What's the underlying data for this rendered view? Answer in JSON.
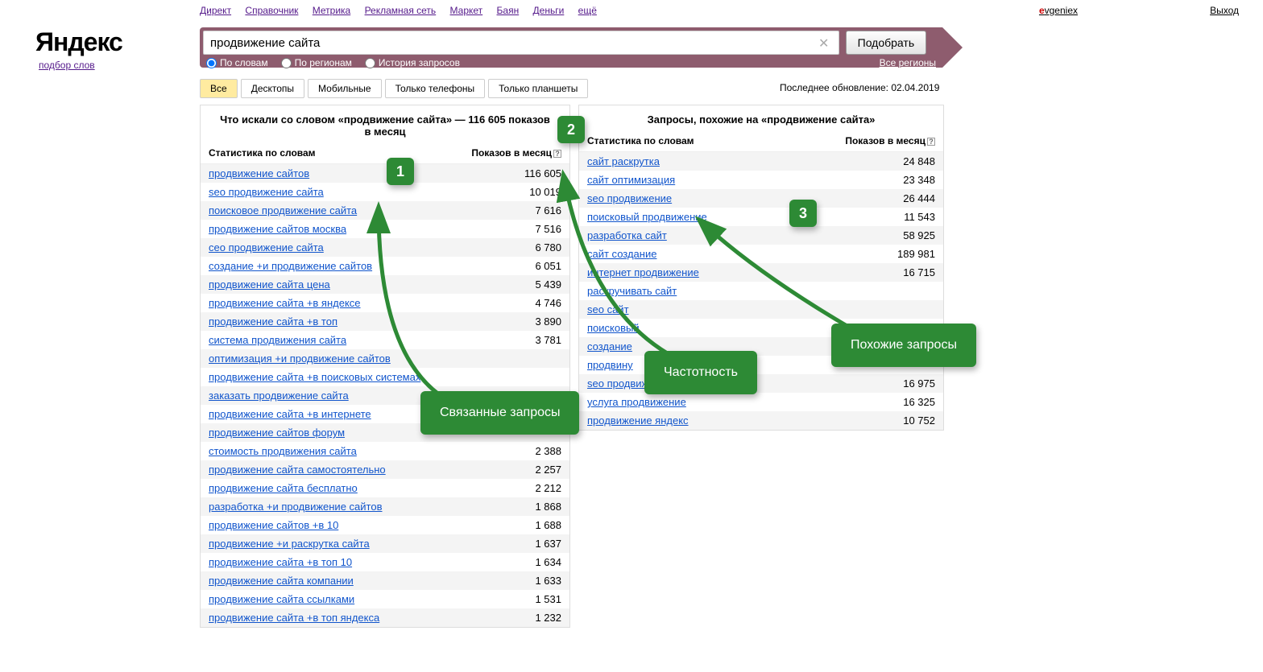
{
  "nav": {
    "links": [
      "Директ",
      "Справочник",
      "Метрика",
      "Рекламная сеть",
      "Маркет",
      "Баян",
      "Деньги",
      "ещё"
    ],
    "user": "vgeniex",
    "logout": "Выход"
  },
  "logo": {
    "brand": "Яндекс",
    "sub": "подбор слов"
  },
  "search": {
    "value": "продвижение сайта",
    "button": "Подобрать",
    "radio_words": "По словам",
    "radio_regions": "По регионам",
    "radio_history": "История запросов",
    "all_regions": "Все регионы"
  },
  "device_tabs": [
    "Все",
    "Десктопы",
    "Мобильные",
    "Только телефоны",
    "Только планшеты"
  ],
  "last_update": "Последнее обновление: 02.04.2019",
  "left_panel": {
    "title": "Что искали со словом «продвижение сайта» — 116 605 показов в месяц",
    "col1": "Статистика по словам",
    "col2": "Показов в месяц",
    "rows": [
      {
        "q": "продвижение сайтов",
        "n": "116 605"
      },
      {
        "q": "seo продвижение сайта",
        "n": "10 019"
      },
      {
        "q": "поисковое продвижение сайта",
        "n": "7 616"
      },
      {
        "q": "продвижение сайтов москва",
        "n": "7 516"
      },
      {
        "q": "сео продвижение сайта",
        "n": "6 780"
      },
      {
        "q": "создание +и продвижение сайтов",
        "n": "6 051"
      },
      {
        "q": "продвижение сайта цена",
        "n": "5 439"
      },
      {
        "q": "продвижение сайта +в яндексе",
        "n": "4 746"
      },
      {
        "q": "продвижение сайта +в топ",
        "n": "3 890"
      },
      {
        "q": "система продвижения сайта",
        "n": "3 781"
      },
      {
        "q": "оптимизация +и продвижение сайтов",
        "n": ""
      },
      {
        "q": "продвижение сайта +в поисковых системах",
        "n": ""
      },
      {
        "q": "заказать продвижение сайта",
        "n": ""
      },
      {
        "q": "продвижение сайта +в интернете",
        "n": ""
      },
      {
        "q": "продвижение сайтов форум",
        "n": ""
      },
      {
        "q": "стоимость продвижения сайта",
        "n": "2 388"
      },
      {
        "q": "продвижение сайта самостоятельно",
        "n": "2 257"
      },
      {
        "q": "продвижение сайта бесплатно",
        "n": "2 212"
      },
      {
        "q": "разработка +и продвижение сайтов",
        "n": "1 868"
      },
      {
        "q": "продвижение сайтов +в 10",
        "n": "1 688"
      },
      {
        "q": "продвижение +и раскрутка сайта",
        "n": "1 637"
      },
      {
        "q": "продвижение сайта +в топ 10",
        "n": "1 634"
      },
      {
        "q": "продвижение сайта компании",
        "n": "1 633"
      },
      {
        "q": "продвижение сайта ссылками",
        "n": "1 531"
      },
      {
        "q": "продвижение сайта +в топ яндекса",
        "n": "1 232"
      }
    ]
  },
  "right_panel": {
    "title": "Запросы, похожие на «продвижение сайта»",
    "col1": "Статистика по словам",
    "col2": "Показов в месяц",
    "rows": [
      {
        "q": "сайт раскрутка",
        "n": "24 848"
      },
      {
        "q": "сайт оптимизация",
        "n": "23 348"
      },
      {
        "q": "seo продвижение",
        "n": "26 444"
      },
      {
        "q": "поисковый продвижение",
        "n": "11 543"
      },
      {
        "q": "разработка сайт",
        "n": "58 925"
      },
      {
        "q": "сайт создание",
        "n": "189 981"
      },
      {
        "q": "интернет продвижение",
        "n": "16 715"
      },
      {
        "q": "раскручивать сайт",
        "n": ""
      },
      {
        "q": "seo сайт",
        "n": ""
      },
      {
        "q": "поисковый",
        "n": ""
      },
      {
        "q": "создание",
        "n": ""
      },
      {
        "q": "продвину",
        "n": ""
      },
      {
        "q": "seo продвижение",
        "n": "16 975"
      },
      {
        "q": "услуга продвижение",
        "n": "16 325"
      },
      {
        "q": "продвижение яндекс",
        "n": "10 752"
      }
    ]
  },
  "annotations": {
    "n1": "1",
    "n2": "2",
    "n3": "3",
    "related": "Связанные запросы",
    "freq": "Частотность",
    "similar": "Похожие запросы"
  }
}
